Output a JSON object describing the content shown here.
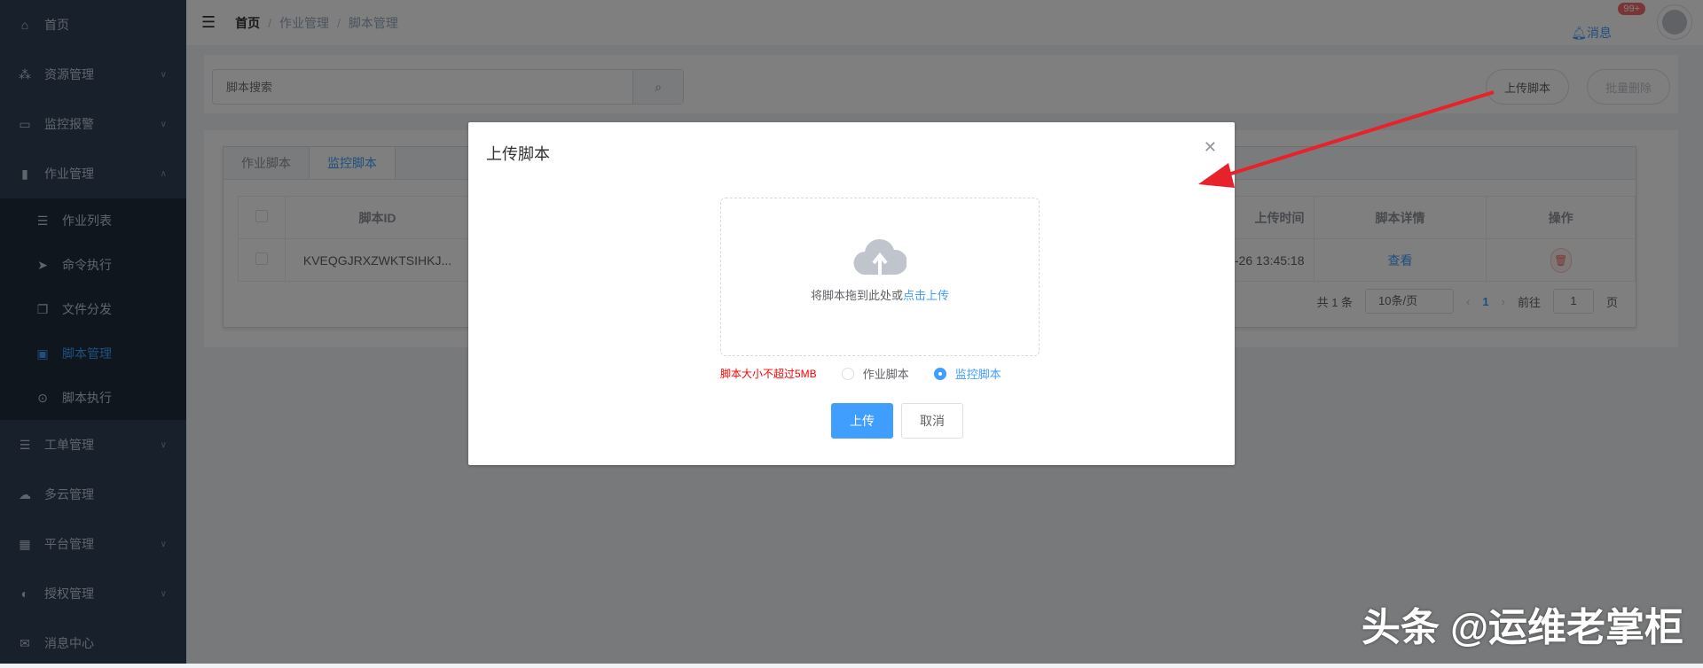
{
  "sidebar": {
    "items": [
      {
        "label": "首页",
        "icon": "home-icon"
      },
      {
        "label": "资源管理",
        "icon": "resources-icon"
      },
      {
        "label": "监控报警",
        "icon": "monitor-icon"
      },
      {
        "label": "作业管理",
        "icon": "job-icon"
      },
      {
        "label": "工单管理",
        "icon": "sliders-icon"
      },
      {
        "label": "多云管理",
        "icon": "cloud-icon"
      },
      {
        "label": "平台管理",
        "icon": "grid-icon"
      },
      {
        "label": "授权管理",
        "icon": "shield-icon"
      },
      {
        "label": "消息中心",
        "icon": "mail-icon"
      }
    ],
    "submenu": [
      {
        "label": "作业列表"
      },
      {
        "label": "命令执行"
      },
      {
        "label": "文件分发"
      },
      {
        "label": "脚本管理"
      },
      {
        "label": "脚本执行"
      }
    ]
  },
  "header": {
    "breadcrumb": [
      "首页",
      "作业管理",
      "脚本管理"
    ],
    "messages": "消息",
    "badge": "99+"
  },
  "toolbar": {
    "search_placeholder": "脚本搜索",
    "upload": "上传脚本",
    "batch_delete": "批量删除"
  },
  "tabs": [
    "作业脚本",
    "监控脚本"
  ],
  "table": {
    "headers": [
      "脚本ID",
      "上传时间",
      "脚本详情",
      "操作"
    ],
    "rows": [
      {
        "id": "KVEQGJRXZWKTSIHKJ...",
        "time": "-26 13:45:18",
        "detail": "查看"
      }
    ]
  },
  "pagination": {
    "total": "共 1 条",
    "page_size": "10条/页",
    "current": "1",
    "goto": "前往",
    "goto_value": "1",
    "page_unit": "页"
  },
  "modal": {
    "title": "上传脚本",
    "drop_text": "将脚本拖到此处或",
    "drop_link": "点击上传",
    "size_hint": "脚本大小不超过5MB",
    "radio_options": [
      "作业脚本",
      "监控脚本"
    ],
    "selected": "监控脚本",
    "ok": "上传",
    "cancel": "取消"
  },
  "watermark": "头条 @运维老掌柜"
}
